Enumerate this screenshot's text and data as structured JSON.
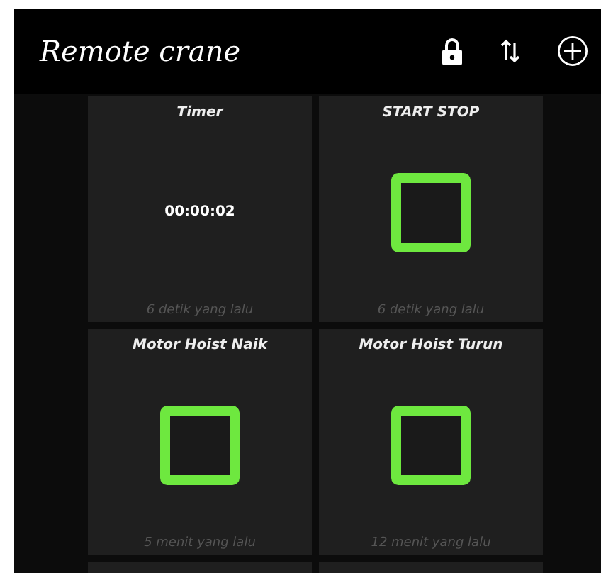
{
  "app_bar": {
    "title": "Remote crane"
  },
  "widgets": [
    {
      "kind": "text",
      "title": "Timer",
      "value": "00:00:02",
      "updated": "6 detik yang lalu"
    },
    {
      "kind": "button",
      "title": "START STOP",
      "updated": "6 detik yang lalu"
    },
    {
      "kind": "button",
      "title": "Motor Hoist Naik",
      "updated": "5 menit yang lalu"
    },
    {
      "kind": "button",
      "title": "Motor Hoist Turun",
      "updated": "12 menit yang lalu"
    }
  ]
}
